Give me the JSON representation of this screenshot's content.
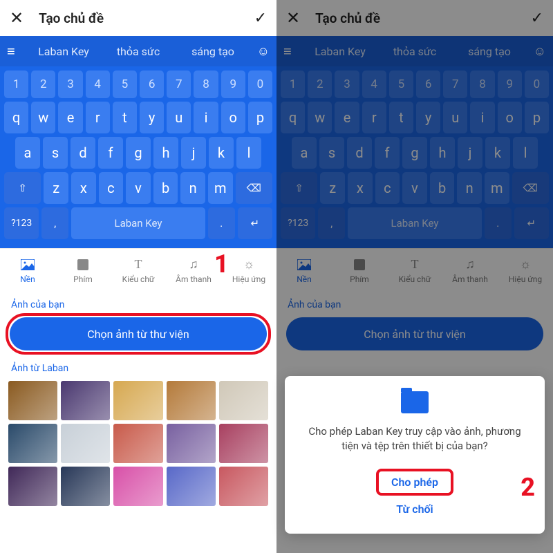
{
  "header": {
    "title": "Tạo chủ đề"
  },
  "suggest": {
    "w1": "Laban Key",
    "w2": "thỏa sức",
    "w3": "sáng tạo"
  },
  "keys": {
    "numbers": [
      "1",
      "2",
      "3",
      "4",
      "5",
      "6",
      "7",
      "8",
      "9",
      "0"
    ],
    "row1": [
      "q",
      "w",
      "e",
      "r",
      "t",
      "y",
      "u",
      "i",
      "o",
      "p"
    ],
    "row2": [
      "a",
      "s",
      "d",
      "f",
      "g",
      "h",
      "j",
      "k",
      "l"
    ],
    "row3": [
      "z",
      "x",
      "c",
      "v",
      "b",
      "n",
      "m"
    ],
    "sym": "?123",
    "space": "Laban Key"
  },
  "tabs": [
    {
      "label": "Nền"
    },
    {
      "label": "Phím"
    },
    {
      "label": "Kiểu chữ"
    },
    {
      "label": "Âm thanh"
    },
    {
      "label": "Hiệu ứng"
    }
  ],
  "sections": {
    "your_photos": "Ảnh của bạn",
    "laban_photos": "Ảnh từ Laban"
  },
  "pick_button": "Chọn ảnh từ thư viện",
  "step1": "1",
  "step2": "2",
  "modal": {
    "message": "Cho phép Laban Key truy cập vào ảnh, phương tiện và tệp trên thiết bị của bạn?",
    "allow": "Cho phép",
    "deny": "Từ chối"
  },
  "thumb_colors": [
    [
      "#8a5a20",
      "#4a3870",
      "#d6a850",
      "#b47a3a",
      "#d0c8b8"
    ],
    [
      "#2a4a6a",
      "#c8d0d8",
      "#c85a4a",
      "#7860a0",
      "#a84060"
    ],
    [
      "#402858",
      "#283858",
      "#d850a8",
      "#5868c8",
      "#c85860"
    ]
  ]
}
